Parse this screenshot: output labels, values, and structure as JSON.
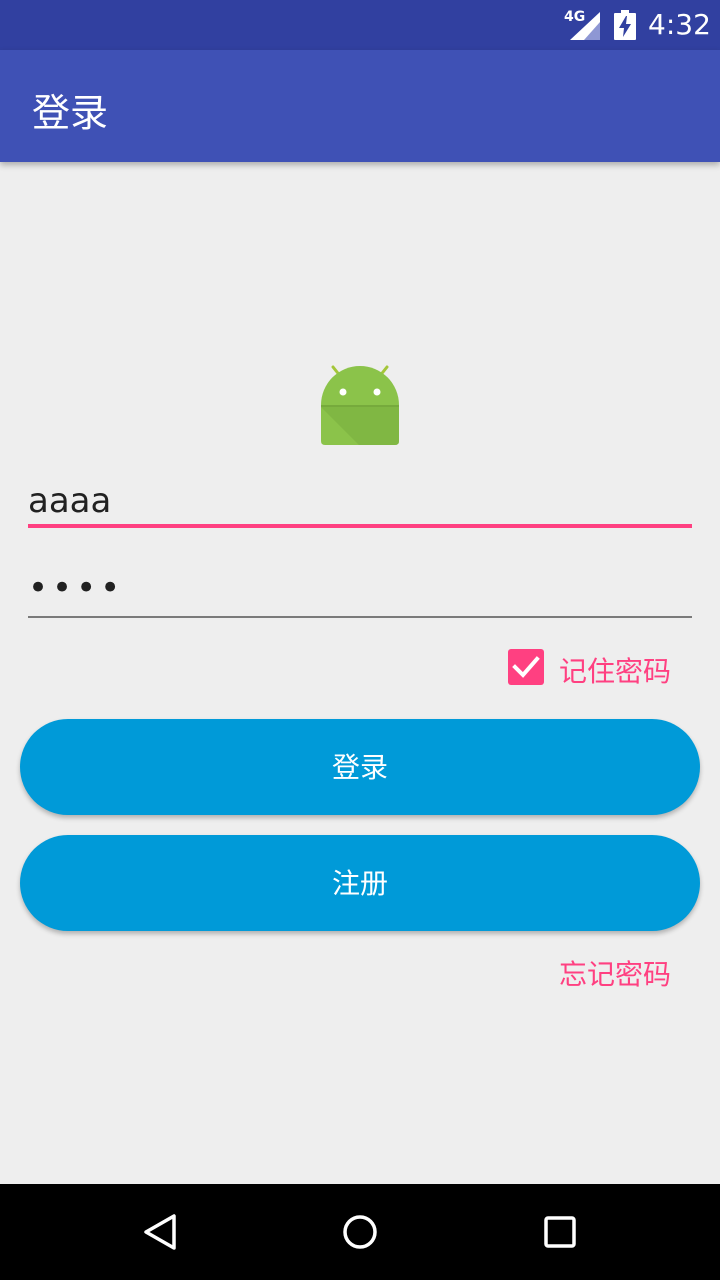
{
  "status_bar": {
    "network": "4G",
    "time": "4:32"
  },
  "toolbar": {
    "title": "登录"
  },
  "login_form": {
    "username_value": "aaaa",
    "password_value": "••••",
    "remember_password_label": "记住密码",
    "remember_password_checked": true,
    "login_button_label": "登录",
    "register_button_label": "注册",
    "forgot_password_label": "忘记密码"
  },
  "colors": {
    "primary": "#3f51b5",
    "primary_dark": "#3140a0",
    "accent": "#ff4081",
    "button": "#009ad8",
    "android_green": "#a4c639"
  },
  "nav_bar": {
    "icons": [
      "back-icon",
      "home-icon",
      "recents-icon"
    ]
  }
}
